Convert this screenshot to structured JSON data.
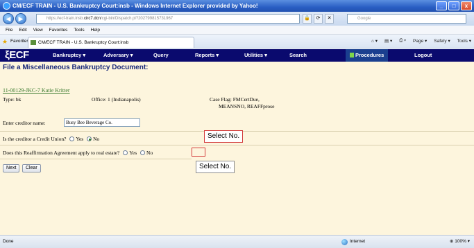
{
  "window": {
    "title": "CM/ECF TRAIN - U.S. Bankruptcy Court:insb - Windows Internet Explorer provided by Yahoo!",
    "buttons": {
      "minimize": "_",
      "maximize": "□",
      "close": "x"
    }
  },
  "address_bar": {
    "url_prefix": "https://ecf-train.insb.",
    "url_highlight": "circ7.dcn",
    "url_rest": "/cgi-bin/Dispatch.pl?202799815731967",
    "search_placeholder": "Google"
  },
  "menu": [
    "File",
    "Edit",
    "View",
    "Favorites",
    "Tools",
    "Help"
  ],
  "favorites_bar": {
    "favorites_label": "Favorites",
    "tab_title": "CM/ECF TRAIN - U.S. Bankruptcy Court:insb",
    "commands": [
      "Page ▾",
      "Safety ▾",
      "Tools ▾"
    ]
  },
  "ecf_menu": {
    "logo": "ECF",
    "items": [
      "Bankruptcy ▾",
      "Adversary ▾",
      "Query",
      "Reports ▾",
      "Utilities ▾",
      "Search",
      "Procedures",
      "Logout"
    ]
  },
  "page": {
    "title": "File a Miscellaneous Bankruptcy Document:",
    "case_number": "11-00129-JKC-7 Katie Kritter",
    "type_label": "Type: bk",
    "office_label": "Office: 1 (Indianapolis)",
    "case_flag_line1": "Case Flag: FMCertDue,",
    "case_flag_line2": "MEANSNO, REAFFprose",
    "creditor_label": "Enter creditor name:",
    "creditor_value": "Busy Bee Beverage Co.",
    "q1_text": "Is the creditor a Credit Union?",
    "q1_yes": "Yes",
    "q1_no": "No",
    "q2_text": "Does this Reaffirmation Agreement apply to real estate?",
    "q2_yes": "Yes",
    "q2_no": "No",
    "callout1": "Select No.",
    "callout2": "Select No.",
    "next_button": "Next",
    "clear_button": "Clear"
  },
  "status_bar": {
    "status": "Done",
    "zone": "Internet",
    "zoom": "100%"
  }
}
